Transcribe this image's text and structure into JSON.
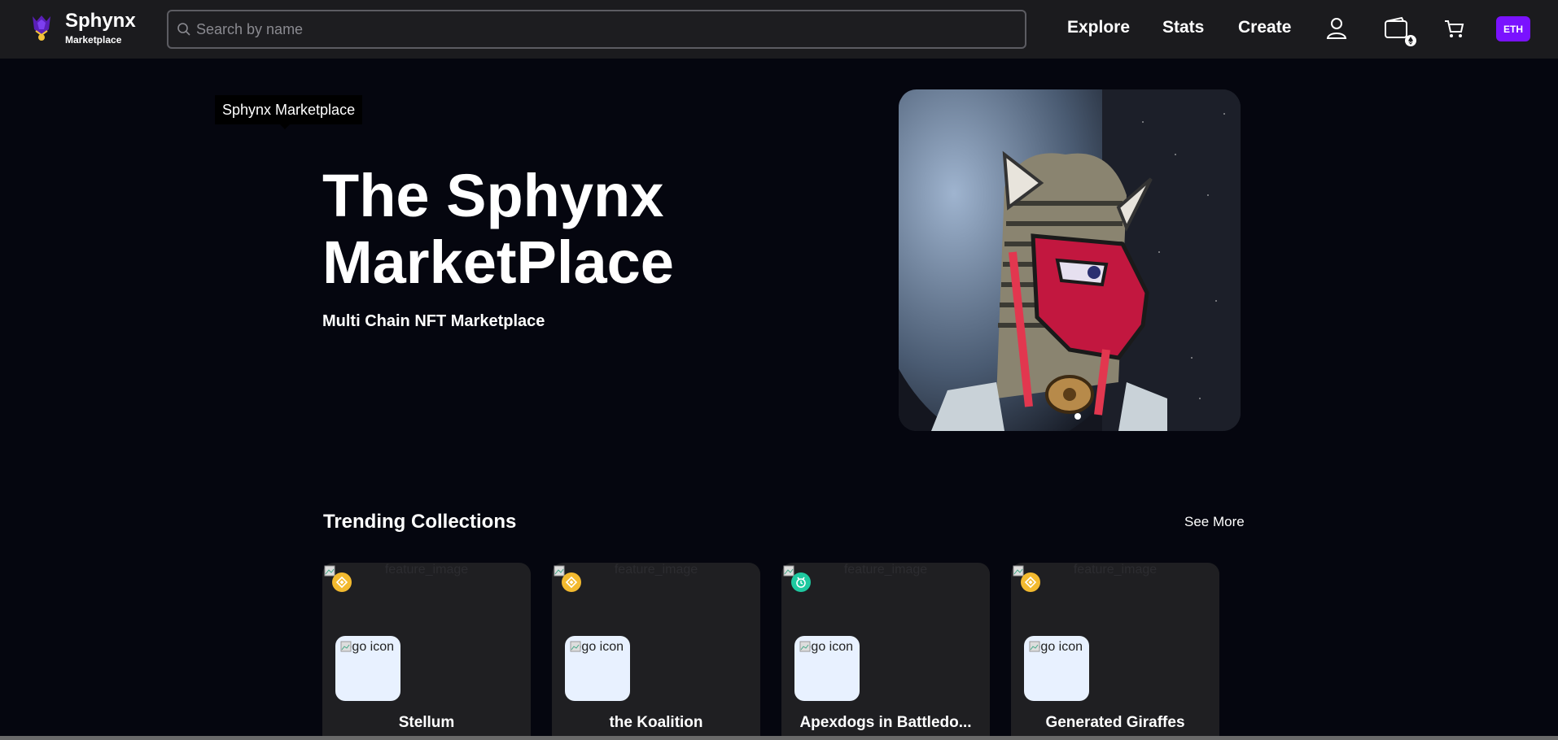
{
  "header": {
    "brand_name": "Sphynx",
    "brand_sub": "Marketplace",
    "search_placeholder": "Search by name",
    "nav": [
      "Explore",
      "Stats",
      "Create"
    ],
    "network_button": "ETH",
    "icons": [
      "user-icon",
      "wallet-icon",
      "cart-icon"
    ]
  },
  "hero": {
    "tooltip": "Sphynx Marketplace",
    "title": "The Sphynx MarketPlace",
    "subtitle": "Multi Chain NFT Marketplace",
    "carousel_dots": 1
  },
  "trending": {
    "title": "Trending Collections",
    "see_more": "See More",
    "cards": [
      {
        "name": "Stellum",
        "feature_alt": "feature_image",
        "logo_alt": "logo icon",
        "chain": "bnb",
        "chain_color": "#f3ba2f"
      },
      {
        "name": "the Koalition",
        "feature_alt": "feature_image",
        "logo_alt": "logo icon",
        "chain": "bnb",
        "chain_color": "#f3ba2f"
      },
      {
        "name": "Apexdogs in Battledo...",
        "feature_alt": "feature_image",
        "logo_alt": "logo icon",
        "chain": "other",
        "chain_color": "#1ec9a0"
      },
      {
        "name": "Generated Giraffes",
        "feature_alt": "feature_image",
        "logo_alt": "logo icon",
        "chain": "bnb",
        "chain_color": "#f3ba2f"
      }
    ]
  },
  "colors": {
    "background": "#05060f",
    "header": "#1b1b1e",
    "accent": "#7a12ff",
    "card": "#1f1f22"
  }
}
